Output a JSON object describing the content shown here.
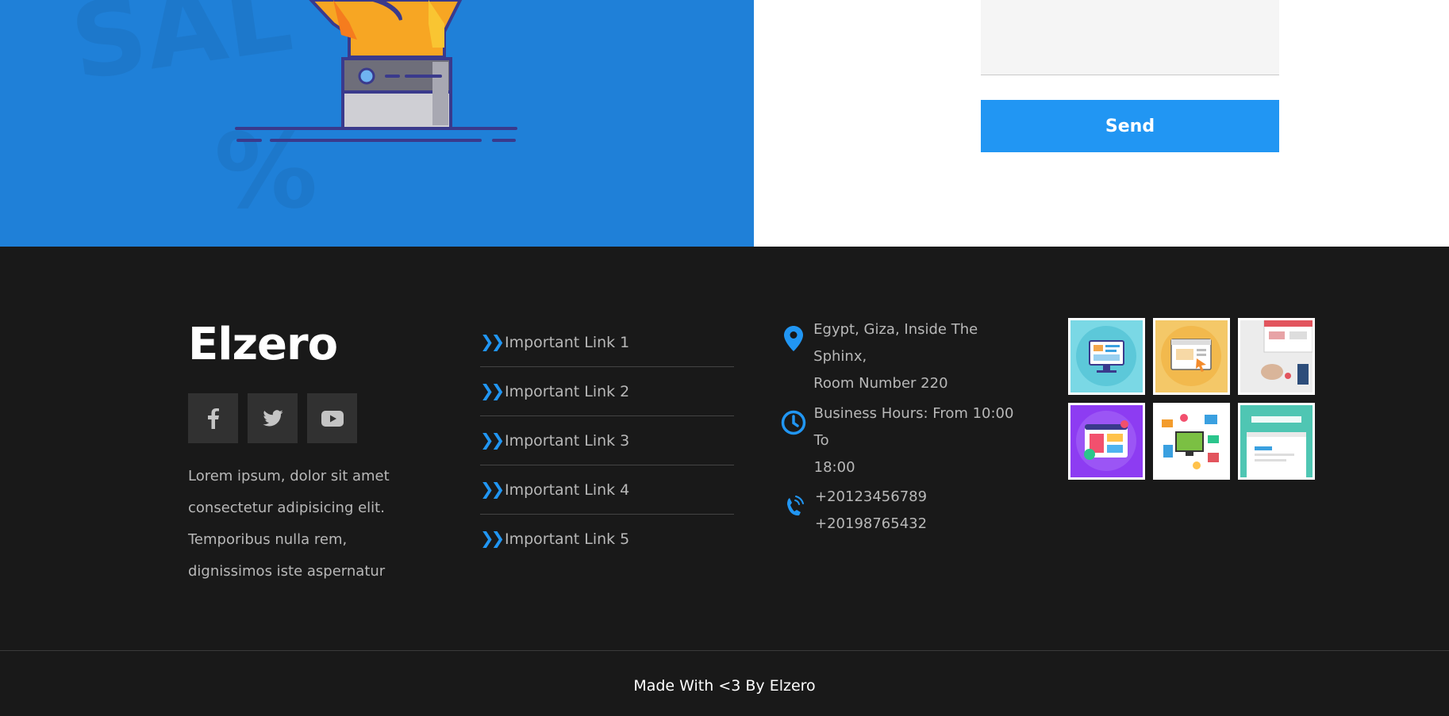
{
  "contact": {
    "send_label": "Send"
  },
  "footer": {
    "brand": "Elzero",
    "social": [
      {
        "icon": "facebook-icon"
      },
      {
        "icon": "twitter-icon"
      },
      {
        "icon": "youtube-icon"
      }
    ],
    "description": "Lorem ipsum, dolor sit amet consectetur adipisicing elit. Temporibus nulla rem, dignissimos iste aspernatur",
    "links": [
      {
        "label": "Important Link 1"
      },
      {
        "label": "Important Link 2"
      },
      {
        "label": "Important Link 3"
      },
      {
        "label": "Important Link 4"
      },
      {
        "label": "Important Link 5"
      }
    ],
    "contact_info": {
      "address_line1": "Egypt, Giza, Inside The Sphinx,",
      "address_line2": "Room Number 220",
      "hours_line1": "Business Hours: From 10:00 To",
      "hours_line2": "18:00",
      "phone1": "+20123456789",
      "phone2": "+20198765432"
    },
    "gallery": [
      {
        "icon": "monitor-illustration"
      },
      {
        "icon": "browser-illustration"
      },
      {
        "icon": "desk-photo"
      },
      {
        "icon": "ui-design-illustration"
      },
      {
        "icon": "devices-illustration"
      },
      {
        "icon": "web-design-illustration"
      }
    ],
    "copyright": "Made With <3 By Elzero"
  },
  "colors": {
    "accent": "#2196f3",
    "hero_bg": "#1f80d8",
    "footer_bg": "#191919"
  }
}
